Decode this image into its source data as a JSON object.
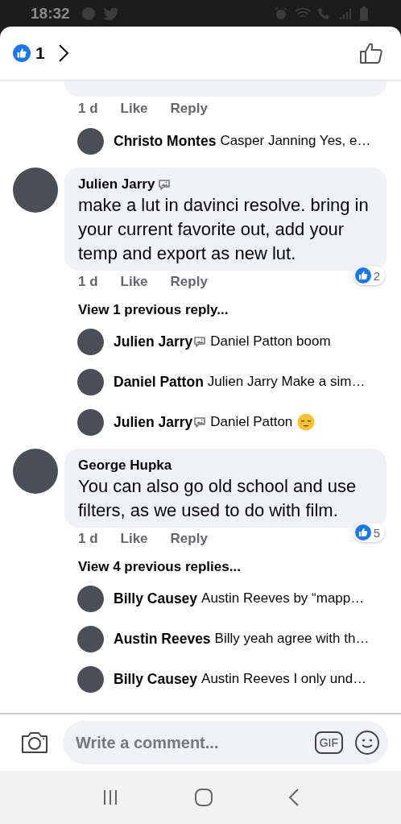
{
  "status_bar": {
    "time": "18:32"
  },
  "header": {
    "reaction_count": "1"
  },
  "items": [
    {
      "kind": "tail",
      "time": "1 d",
      "like": "Like",
      "reply": "Reply"
    },
    {
      "kind": "reply",
      "author": "Christo Montes",
      "badge": false,
      "text": "Casper Janning Yes, e…",
      "emoji": false
    },
    {
      "kind": "comment",
      "author": "Julien Jarry",
      "badge": true,
      "text": "make a lut in davinci resolve. bring in your current favorite out, add your temp and export as new lut.",
      "time": "1 d",
      "like": "Like",
      "reply": "Reply",
      "reactions": "2"
    },
    {
      "kind": "more",
      "text": "View 1 previous reply..."
    },
    {
      "kind": "reply",
      "author": "Julien Jarry",
      "badge": true,
      "text": "Daniel Patton boom",
      "emoji": false
    },
    {
      "kind": "reply",
      "author": "Daniel Patton",
      "badge": false,
      "text": "Julien Jarry Make a sim…",
      "emoji": false
    },
    {
      "kind": "reply",
      "author": "Julien Jarry",
      "badge": true,
      "text": "Daniel Patton",
      "emoji": true
    },
    {
      "kind": "comment",
      "author": "George Hupka",
      "badge": false,
      "text": "You can also go old school and use filters, as we used to do with film.",
      "time": "1 d",
      "like": "Like",
      "reply": "Reply",
      "reactions": "5"
    },
    {
      "kind": "more",
      "text": "View 4 previous replies..."
    },
    {
      "kind": "reply",
      "author": "Billy Causey",
      "badge": false,
      "text": "Austin Reeves  by “mapp…",
      "emoji": false
    },
    {
      "kind": "reply",
      "author": "Austin Reeves",
      "badge": false,
      "text": "Billy yeah agree with th…",
      "emoji": false
    },
    {
      "kind": "reply",
      "author": "Billy Causey",
      "badge": false,
      "text": "Austin Reeves  I only und…",
      "emoji": false
    }
  ],
  "composer": {
    "placeholder": "Write a comment...",
    "gif": "GIF"
  }
}
